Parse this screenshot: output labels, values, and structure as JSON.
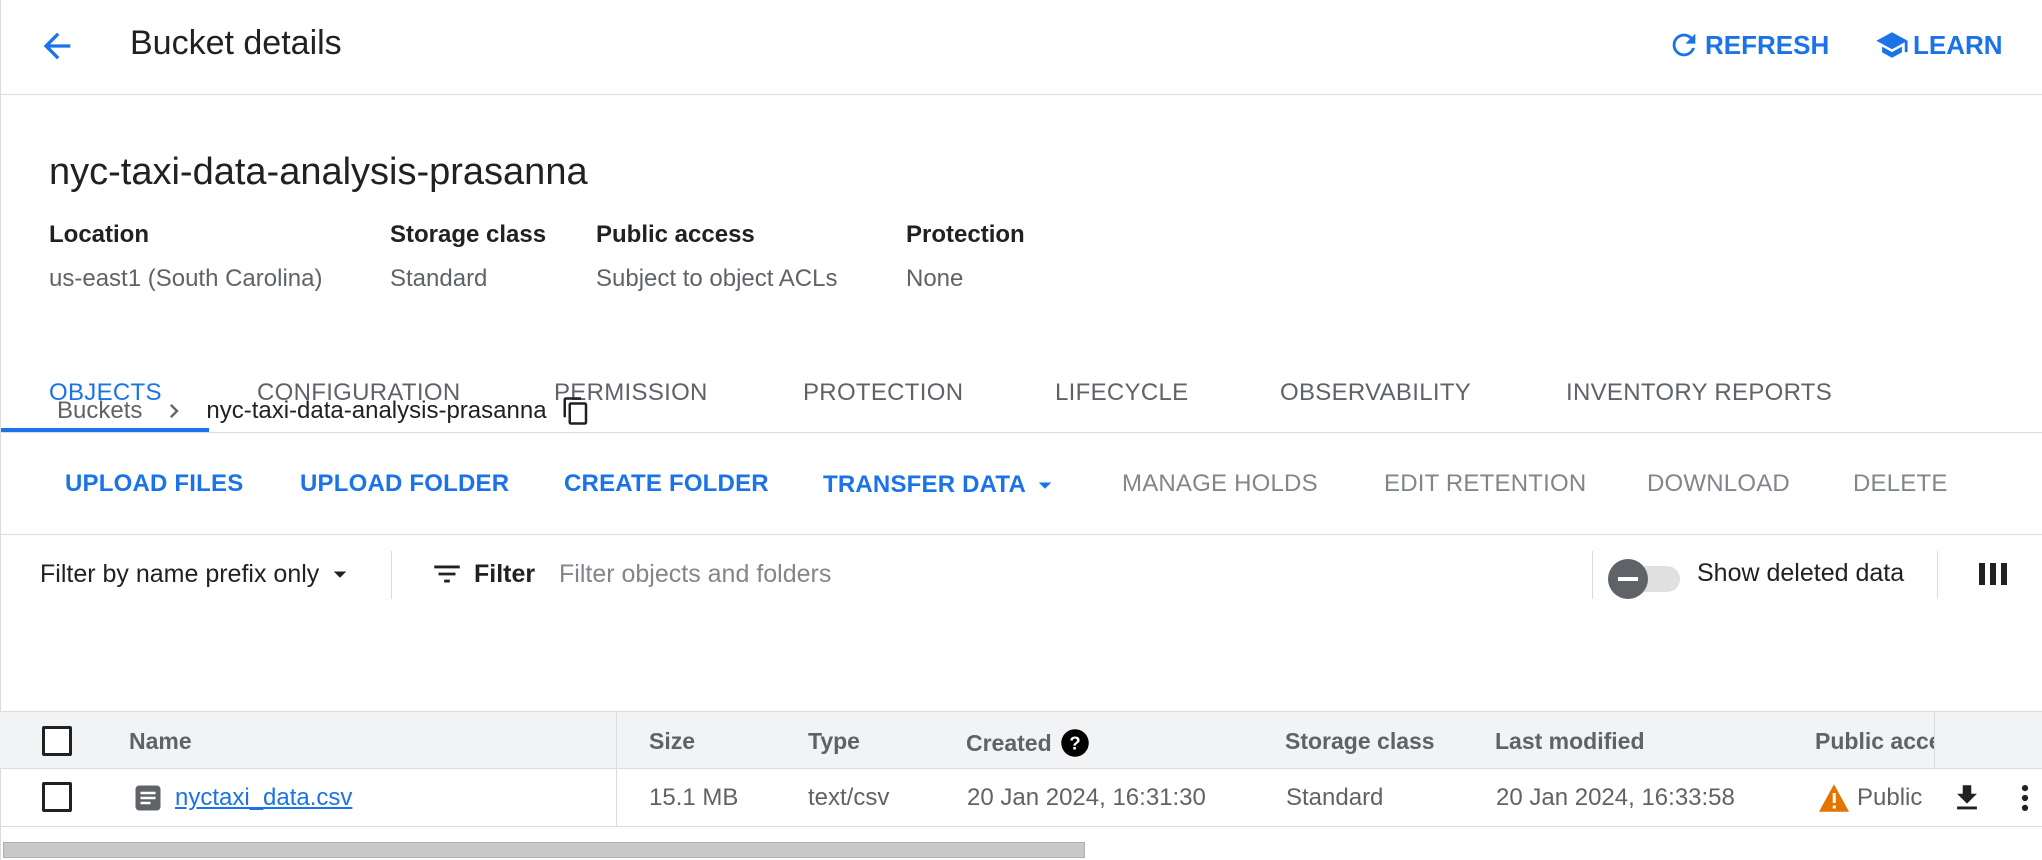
{
  "header": {
    "title": "Bucket details",
    "refresh_label": "REFRESH",
    "learn_label": "LEARN"
  },
  "bucket": {
    "name": "nyc-taxi-data-analysis-prasanna",
    "properties": [
      {
        "label": "Location",
        "value": "us-east1 (South Carolina)"
      },
      {
        "label": "Storage class",
        "value": "Standard"
      },
      {
        "label": "Public access",
        "value": "Subject to object ACLs"
      },
      {
        "label": "Protection",
        "value": "None"
      }
    ]
  },
  "tabs": [
    {
      "label": "OBJECTS",
      "active": true
    },
    {
      "label": "CONFIGURATION"
    },
    {
      "label": "PERMISSION"
    },
    {
      "label": "PROTECTION"
    },
    {
      "label": "LIFECYCLE"
    },
    {
      "label": "OBSERVABILITY"
    },
    {
      "label": "INVENTORY REPORTS"
    }
  ],
  "breadcrumb": {
    "root": "Buckets",
    "current": "nyc-taxi-data-analysis-prasanna"
  },
  "toolbar": {
    "upload_files": "UPLOAD FILES",
    "upload_folder": "UPLOAD FOLDER",
    "create_folder": "CREATE FOLDER",
    "transfer_data": "TRANSFER DATA",
    "manage_holds": "MANAGE HOLDS",
    "edit_retention": "EDIT RETENTION",
    "download": "DOWNLOAD",
    "delete": "DELETE"
  },
  "filter": {
    "mode": "Filter by name prefix only",
    "button": "Filter",
    "placeholder": "Filter objects and folders",
    "show_deleted_label": "Show deleted data"
  },
  "table": {
    "columns": {
      "name": "Name",
      "size": "Size",
      "type": "Type",
      "created": "Created",
      "storage_class": "Storage class",
      "last_modified": "Last modified",
      "public_access": "Public access"
    },
    "rows": [
      {
        "name": "nyctaxi_data.csv",
        "size": "15.1 MB",
        "type": "text/csv",
        "created": "20 Jan 2024, 16:31:30",
        "storage_class": "Standard",
        "last_modified": "20 Jan 2024, 16:33:58",
        "public_access": "Public"
      }
    ]
  },
  "colors": {
    "accent": "#1a73e8",
    "warning": "#e37400",
    "muted": "#5f6368",
    "border": "#dadce0"
  }
}
